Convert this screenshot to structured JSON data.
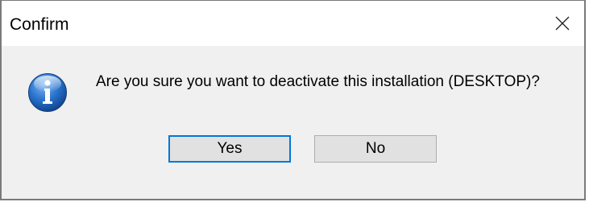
{
  "window": {
    "title": "Confirm",
    "close_icon": "close-icon"
  },
  "dialog": {
    "icon": "info-icon",
    "message": "Are you sure you want to deactivate this installation (DESKTOP)?"
  },
  "buttons": {
    "yes_label": "Yes",
    "no_label": "No"
  },
  "colors": {
    "icon_blue": "#1c5fb0",
    "default_button_border": "#0078d7",
    "button_face": "#e1e1e1",
    "client_bg": "#f0f0f0"
  }
}
